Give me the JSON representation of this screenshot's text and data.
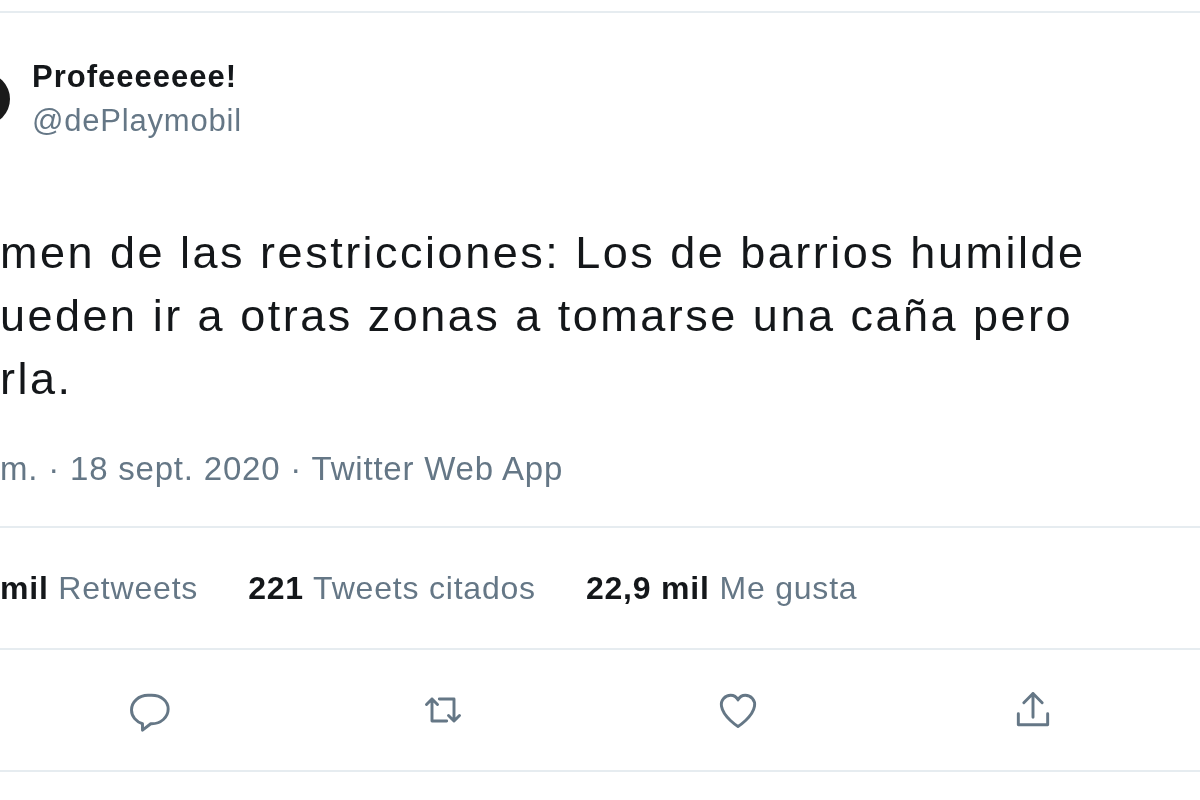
{
  "author": {
    "name": "Profeeeeeee!",
    "handle": "@dePlaymobil"
  },
  "tweet_lines": [
    "men de las restricciones: Los de barrios humilde",
    "ueden ir a otras zonas a tomarse una caña pero",
    "rla."
  ],
  "meta": "m. · 18 sept. 2020 · Twitter Web App",
  "stats": [
    {
      "count": "mil",
      "label": "Retweets"
    },
    {
      "count": "221",
      "label": "Tweets citados"
    },
    {
      "count": "22,9 mil",
      "label": "Me gusta"
    }
  ],
  "actions": [
    {
      "kind": "reply"
    },
    {
      "kind": "retweet"
    },
    {
      "kind": "like"
    },
    {
      "kind": "share"
    }
  ]
}
